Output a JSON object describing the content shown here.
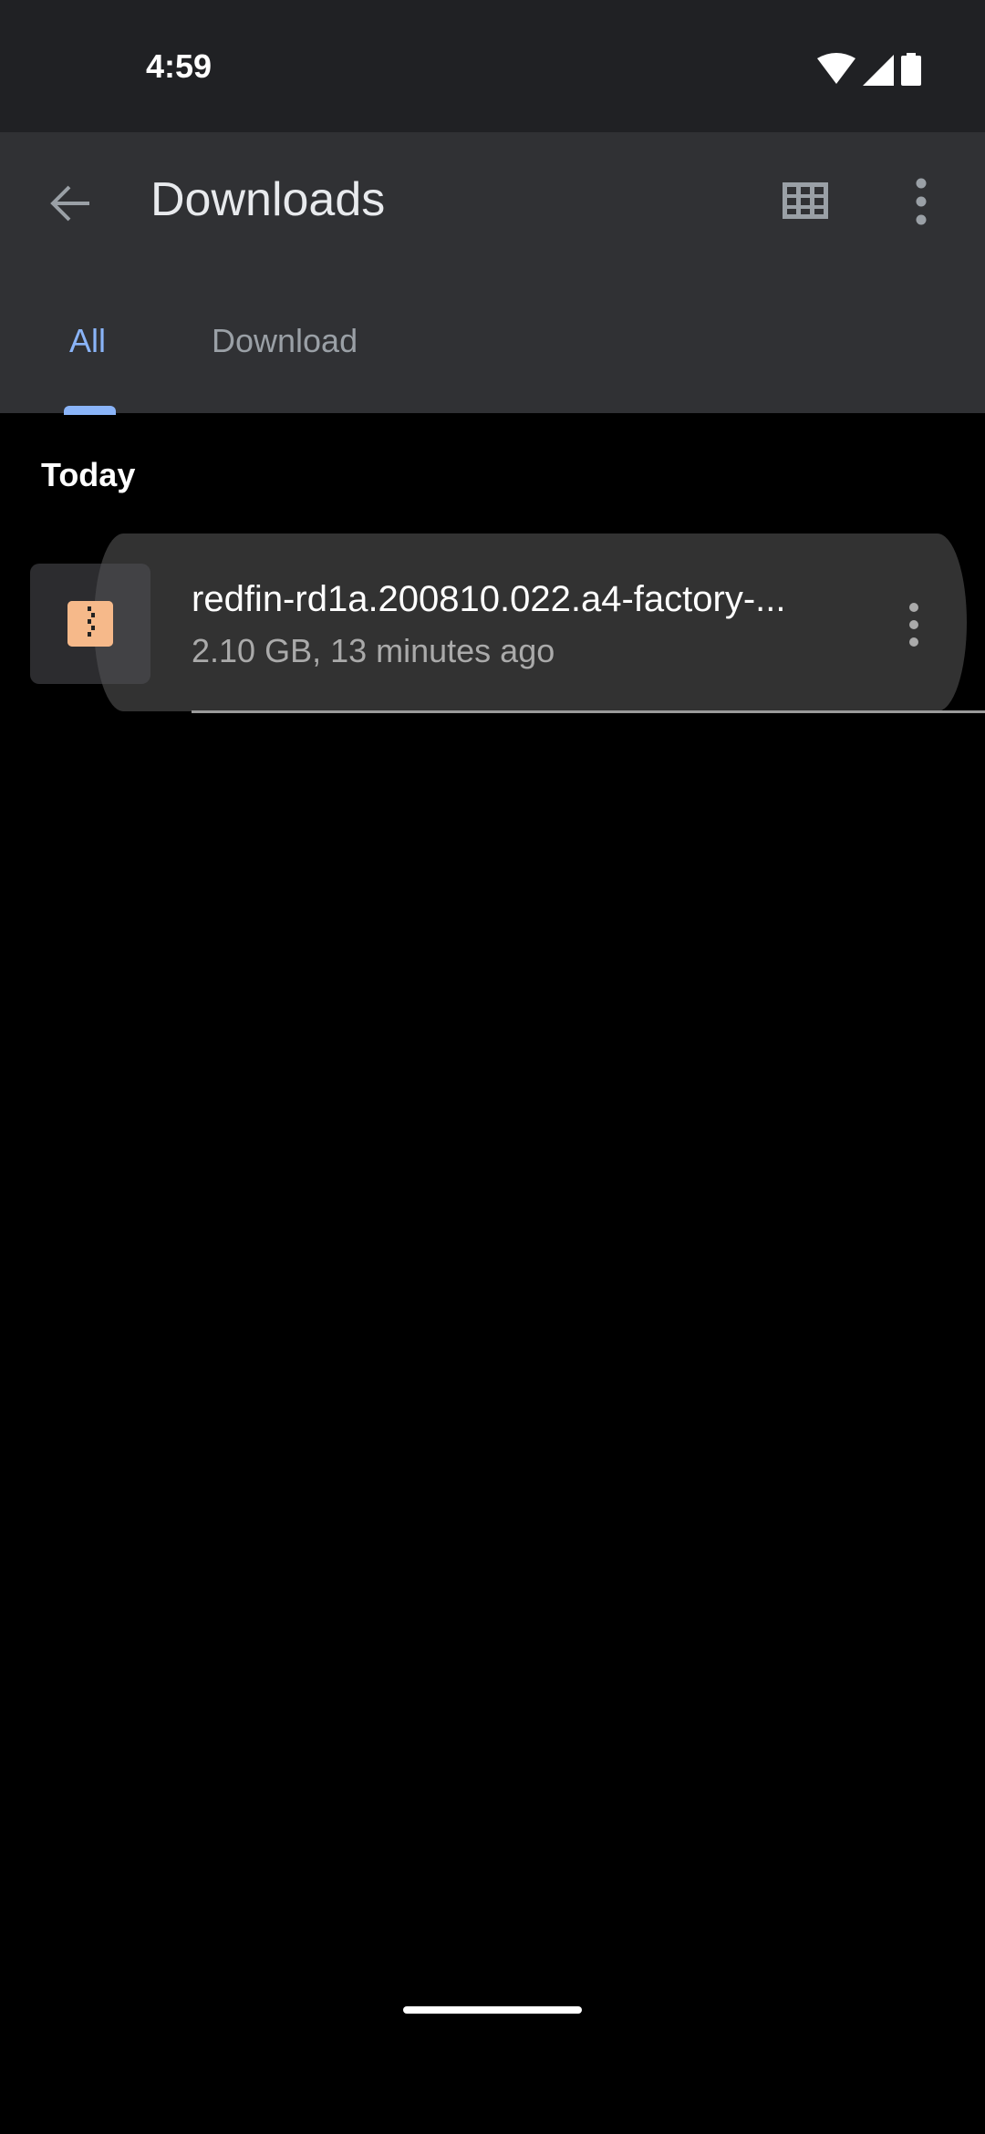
{
  "status_bar": {
    "time": "4:59",
    "icons": [
      "wifi-icon",
      "signal-icon",
      "battery-icon"
    ]
  },
  "app_bar": {
    "title": "Downloads",
    "back_icon": "arrow-back-icon",
    "grid_icon": "grid-view-icon",
    "more_icon": "more-vert-icon"
  },
  "tabs": [
    {
      "label": "All",
      "selected": true
    },
    {
      "label": "Download",
      "selected": false
    }
  ],
  "colors": {
    "accent": "#8ab4f8",
    "app_bar": "#303134",
    "status_bar": "#202124",
    "zip_icon": "#f6b98a"
  },
  "sections": [
    {
      "header": "Today",
      "items": [
        {
          "name": "redfin-rd1a.200810.022.a4-factory-...",
          "meta": "2.10 GB, 13 minutes ago",
          "icon": "zip-file-icon"
        }
      ]
    }
  ]
}
